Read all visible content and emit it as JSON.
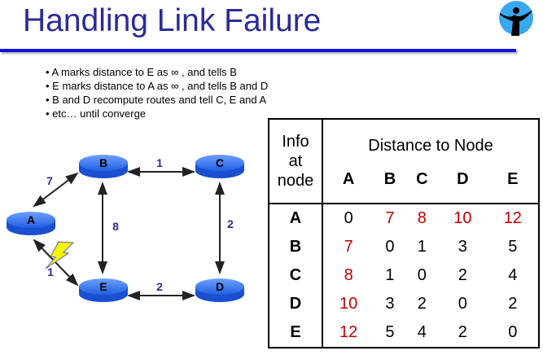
{
  "title": "Handling Link Failure",
  "bullets": [
    "A marks distance to E as ∞ , and tells B",
    "E marks distance to A as ∞ , and tells B and D",
    "B and D recompute routes and tell C, E and A",
    "etc… until converge"
  ],
  "diagram": {
    "nodes": [
      "A",
      "B",
      "C",
      "D",
      "E"
    ],
    "links": [
      {
        "from": "A",
        "to": "B",
        "cost": "7"
      },
      {
        "from": "B",
        "to": "C",
        "cost": "1"
      },
      {
        "from": "B",
        "to": "E",
        "cost": "8"
      },
      {
        "from": "C",
        "to": "D",
        "cost": "2"
      },
      {
        "from": "E",
        "to": "D",
        "cost": "2"
      },
      {
        "from": "A",
        "to": "E",
        "cost": "1",
        "failed": true
      }
    ]
  },
  "table": {
    "corner": [
      "Info",
      "at",
      "node"
    ],
    "header": "Distance to Node",
    "columns": [
      "A",
      "B",
      "C",
      "D",
      "E"
    ],
    "rows": [
      {
        "node": "A",
        "values": [
          "0",
          "7",
          "8",
          "10",
          "12"
        ],
        "red": [
          false,
          true,
          true,
          true,
          true
        ]
      },
      {
        "node": "B",
        "values": [
          "7",
          "0",
          "1",
          "3",
          "5"
        ],
        "red": [
          true,
          false,
          false,
          false,
          false
        ]
      },
      {
        "node": "C",
        "values": [
          "8",
          "1",
          "0",
          "2",
          "4"
        ],
        "red": [
          true,
          false,
          false,
          false,
          false
        ]
      },
      {
        "node": "D",
        "values": [
          "10",
          "3",
          "2",
          "0",
          "2"
        ],
        "red": [
          true,
          false,
          false,
          false,
          false
        ]
      },
      {
        "node": "E",
        "values": [
          "12",
          "5",
          "4",
          "2",
          "0"
        ],
        "red": [
          true,
          false,
          false,
          false,
          false
        ]
      }
    ]
  },
  "colors": {
    "title": "#2b2b9a",
    "node": "#3f7ff0",
    "red": "#c00000"
  }
}
